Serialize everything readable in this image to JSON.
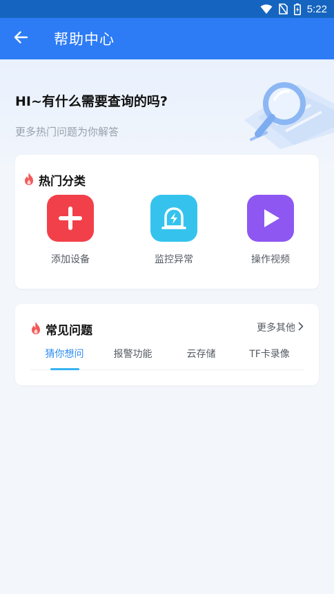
{
  "status_bar": {
    "time": "5:22",
    "icons": [
      "wifi-icon",
      "no-sim-icon",
      "battery-icon"
    ],
    "background": "#1565c0"
  },
  "app_bar": {
    "title": "帮助中心",
    "back_icon": "arrow-left-icon",
    "background": "#2d7cf6"
  },
  "hero": {
    "title": "HI~有什么需要查询的吗?",
    "subtitle": "更多热门问题为你解答",
    "illustration_icon": "magnifier-icon"
  },
  "hot_categories": {
    "title": "热门分类",
    "title_icon": "flame-icon",
    "items": [
      {
        "label": "添加设备",
        "icon": "plus-icon",
        "color": "#f2404a"
      },
      {
        "label": "监控异常",
        "icon": "alarm-lamp-icon",
        "color": "#35c3ee"
      },
      {
        "label": "操作视频",
        "icon": "play-icon",
        "color": "#8e57f2"
      }
    ]
  },
  "faq": {
    "title": "常见问题",
    "title_icon": "flame-icon",
    "more_label": "更多其他",
    "tabs": [
      {
        "label": "猜你想问",
        "active": true
      },
      {
        "label": "报警功能",
        "active": false
      },
      {
        "label": "云存储",
        "active": false
      },
      {
        "label": "TF卡录像",
        "active": false
      }
    ]
  },
  "colors": {
    "accent": "#2d8cf0",
    "tab_indicator": "#36b3f2",
    "flame": "#f25a5a",
    "page_background": "#f3f6fb"
  }
}
